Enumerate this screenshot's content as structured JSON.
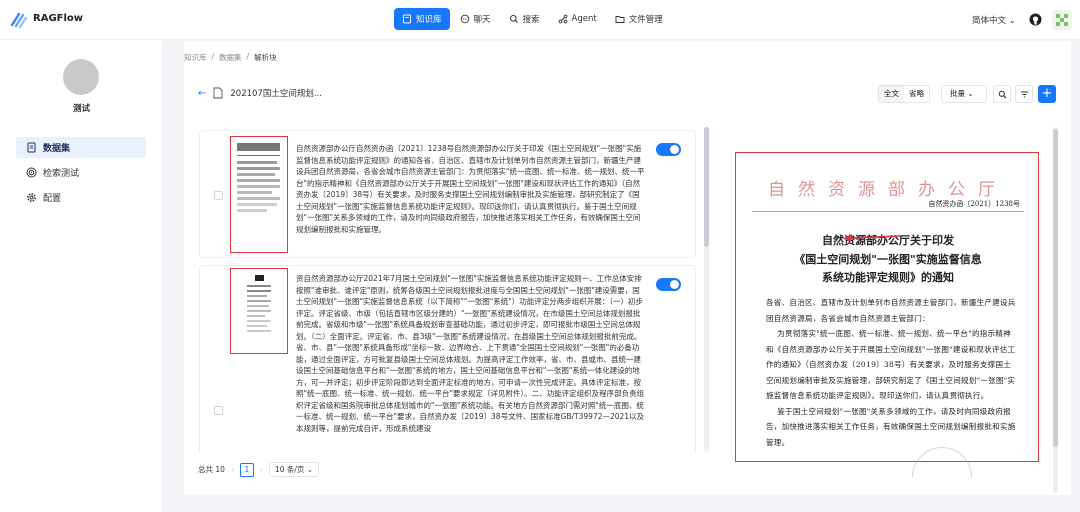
{
  "app": {
    "brand": "RAGFlow",
    "colors": {
      "accent": "#1677ff",
      "highlight": "#d9363e"
    }
  },
  "nav": [
    {
      "label": "知识库",
      "icon": "book-icon",
      "active": true
    },
    {
      "label": "聊天",
      "icon": "chat-icon",
      "active": false
    },
    {
      "label": "搜索",
      "icon": "search-icon",
      "active": false
    },
    {
      "label": "Agent",
      "icon": "agent-icon",
      "active": false
    },
    {
      "label": "文件管理",
      "icon": "folder-icon",
      "active": false
    }
  ],
  "header": {
    "language": "简体中文"
  },
  "sidebar": {
    "user_name": "测试",
    "items": [
      {
        "label": "数据集",
        "icon": "dataset-icon",
        "active": true
      },
      {
        "label": "检索测试",
        "icon": "target-icon",
        "active": false
      },
      {
        "label": "配置",
        "icon": "gear-icon",
        "active": false
      }
    ]
  },
  "breadcrumb": [
    "知识库",
    "数据集",
    "解析块"
  ],
  "document": {
    "name": "202107国土空间规划..."
  },
  "toolbar": {
    "full_text": "全文",
    "ellipsis": "省略",
    "batch": "批量"
  },
  "chunks": [
    {
      "enabled": true,
      "text": "自然资源部办公厅自然资办函〔2021〕1238号自然资源部办公厅关于印发《国土空间规划\"一张图\"实施监督信息系统功能评定规则》的通知各省、自治区、直辖市及计划单列市自然资源主管部门，新疆生产建设兵团自然资源局，各省会城市自然资源主管部门：为贯彻落实\"统一底图、统一标准、统一规划、统一平台\"的指示精神和《自然资源部办公厅关于开展国土空间规划\"一张图\"建设和现状评估工作的通知》（自然资办发〔2019〕38号）有关要求，及时服务支撑国土空间规划编制审批及实施管理，部研究制定了《国土空间规划\"一张图\"实施监督信息系统功能评定规则》。现印送你们，请认真贯彻执行。鉴于国土空间规划\"一张图\"关系多领域的工作，请及时向同级政府报告，加快推进落实相关工作任务，有效确保国土空间规划编制报批和实施管理。"
    },
    {
      "enabled": true,
      "text": "资自然资源部办公厅2021年7月国土空间规划\"一张图\"实施监督信息系统功能评定规则一、工作总体安排按照\"谁审批、谁评定\"原则，统筹各级国土空间规划报批进度与全国国土空间规划\"一张图\"建设需要，国土空间规划\"一张图\"实施监督信息系统（以下简称\"\"一张图\"系统\"）功能评定分两步组织开展：（一）初步评定。评定省级、市级（包括直辖市区级分建的）\"一张图\"系统建设情况，在市级国土空间总体规划报批前完成。省级和市级\"一张图\"系统具备规划审查基础功能，通过初步评定，即可报批市级国土空间总体规划。（二）全面评定。评定省、市、县3级\"一张图\"系统建设情况，在县级国土空间总体规划报批前完成。省、市、县\"一张图\"系统具备形成\"坐标一致、边界吻合、上下贯通\"全国国土空间规划\"一张图\"的必备功能，通过全面评定，方可批复县级国土空间总体规划。为提高评定工作效率，省、市、县或市、县统一建设国土空间基础信息平台和\"一张图\"系统的地方，国土空间基础信息平台和\"一张图\"系统一体化建设的地方，可一并评定；初步评定阶段即达到全面评定标准的地方，可申请一次性完成评定。具体评定标准，按照\"统一底图、统一标准、统一规划、统一平台\"要求规定（详见附件）。二、功能评定组织及程序部负责组织评定省级和国务院审批总体规划城市的\"一张图\"系统功能。有关地方自然资源部门需对照\"统一底图、统一标准、统一规划、统一平台\"要求，自然资办发〔2019〕38号文件、国家标准GB/T39972—2021以及本规则等，提前完成自评，形成系统建设"
    }
  ],
  "pagination": {
    "total_label": "总共 10",
    "current_page": "1",
    "page_size": "10 条/页"
  },
  "preview": {
    "header": "自然资源部办公厅",
    "doc_number": "自然资办函〔2021〕1238号",
    "title_lines": [
      "自然资源部办公厅关于印发",
      "《国土空间规划\"一张图\"实施监督信息",
      "系统功能评定规则》的通知"
    ],
    "paragraphs": [
      "各省、自治区、直辖市及计划单列市自然资源主管部门，新疆生产建设兵团自然资源局，各省会城市自然资源主管部门：",
      "为贯彻落实\"统一底图、统一标准、统一规划、统一平台\"的指示精神和《自然资源部办公厅关于开展国土空间规划\"一张图\"建设和现状评估工作的通知》（自然资办发〔2019〕38号）有关要求，及时服务支撑国土空间规划编制审批及实施管理，部研究制定了《国土空间规划\"一张图\"实施监督信息系统功能评定规则》。现印送你们，请认真贯彻执行。",
      "鉴于国土空间规划\"一张图\"关系多领域的工作，请及时向同级政府报告，加快推进落实相关工作任务，有效确保国土空间规划编制报批和实施管理。"
    ]
  }
}
